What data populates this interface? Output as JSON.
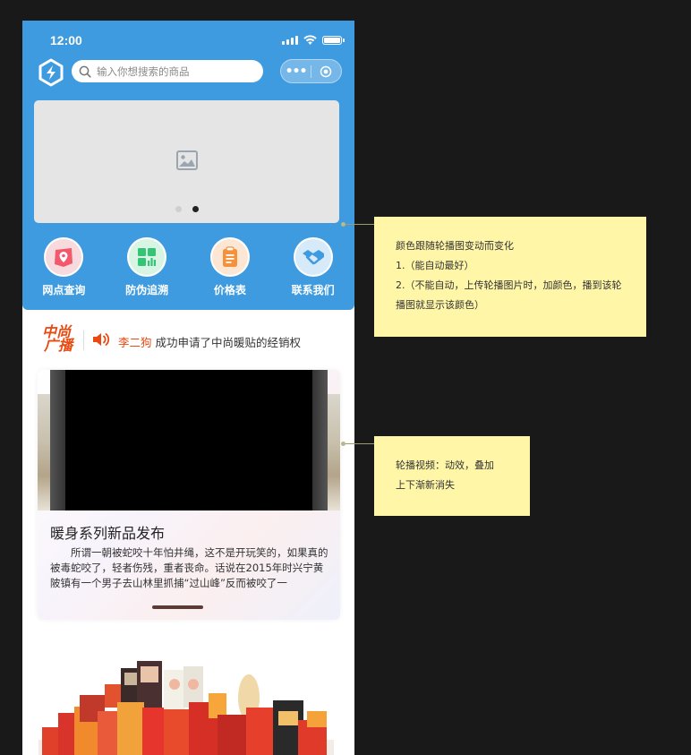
{
  "status_bar": {
    "time": "12:00"
  },
  "header": {
    "logo_icon": "app-logo",
    "search": {
      "placeholder": "输入你想搜索的商品",
      "value": ""
    },
    "capsule": {
      "more_label": "•••",
      "more_icon": "more-dots-icon",
      "close_icon": "target-icon"
    }
  },
  "banner": {
    "image_icon": "image-placeholder-icon",
    "dots": 2,
    "active_dot": 1
  },
  "nav": {
    "items": [
      {
        "label": "网点查询",
        "icon": "map-pin-icon",
        "color": "#f3586b",
        "bg": "#f6dadd"
      },
      {
        "label": "防伪追溯",
        "icon": "grid-chart-icon",
        "color": "#34c476",
        "bg": "#d7f4e4"
      },
      {
        "label": "价格表",
        "icon": "clipboard-icon",
        "color": "#f5903b",
        "bg": "#fde6d3"
      },
      {
        "label": "联系我们",
        "icon": "handshake-icon",
        "color": "#3f9be0",
        "bg": "#d6eaf9"
      }
    ]
  },
  "news": {
    "logo_line1": "中尚",
    "logo_line2": "广播",
    "name": "李二狗",
    "message": "成功申请了中尚暖贴的经销权"
  },
  "card": {
    "title": "暖身系列新品发布",
    "body": "所谓一朝被蛇咬十年怕井绳，这不是开玩笑的，如果真的被毒蛇咬了，轻者伤残，重者丧命。话说在2015年时兴宁黄陂镇有一个男子去山林里抓捕“过山峰”反而被咬了一"
  },
  "annotations": {
    "note1": {
      "line1": "颜色跟随轮播图变动而变化",
      "line2": "1.（能自动最好）",
      "line3": "2.（不能自动，上传轮播图片时，加颜色，播到该轮播图就显示该颜色）"
    },
    "note2": {
      "line1": "轮播视频：动效，叠加",
      "line2": "上下渐新消失"
    }
  },
  "colors": {
    "hero": "#3f9be0",
    "accent": "#e84a12",
    "note": "#fff6a8",
    "background": "#191919"
  }
}
